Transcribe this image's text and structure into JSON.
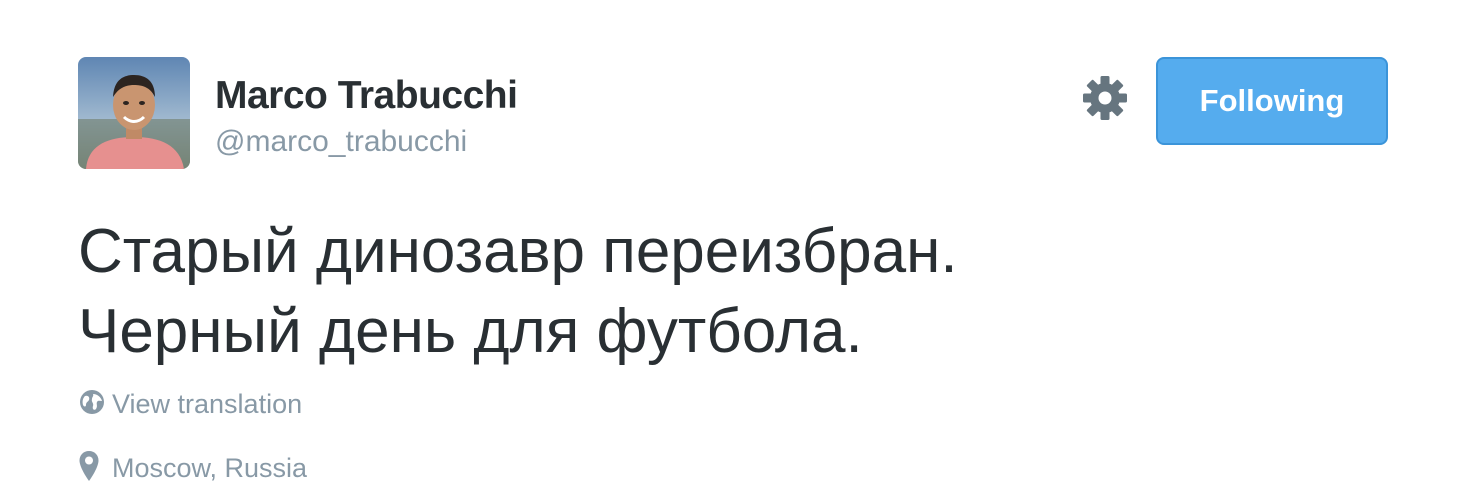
{
  "user": {
    "name": "Marco Trabucchi",
    "handle": "@marco_trabucchi"
  },
  "actions": {
    "settings_icon": "gear-icon",
    "follow_label": "Following",
    "follow_color": "#55acee"
  },
  "tweet": {
    "lines": [
      "Старый динозавр переизбран.",
      "Черный день для футбола."
    ]
  },
  "meta": {
    "translation_icon": "globe-icon",
    "translation_label": "View translation",
    "location_icon": "location-pin-icon",
    "location_label": "Moscow, Russia"
  },
  "colors": {
    "text": "#292f33",
    "secondary": "#8899a6",
    "accent": "#55acee"
  }
}
